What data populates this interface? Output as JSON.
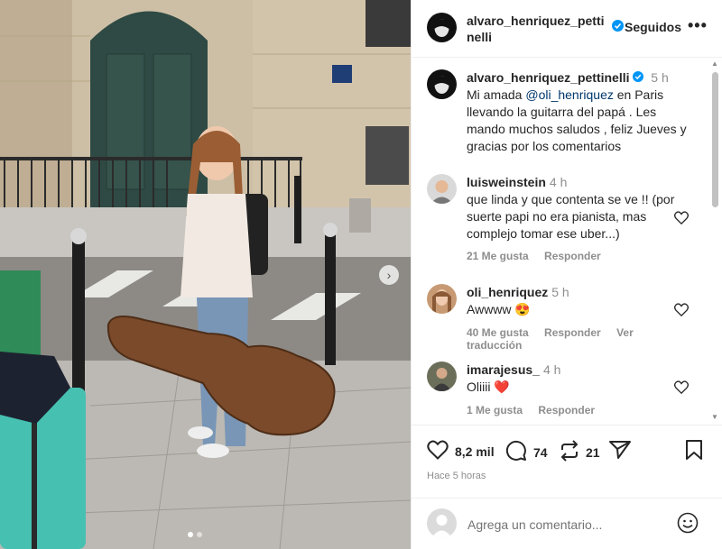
{
  "post": {
    "author": "alvaro_henriquez_pettinelli",
    "follow_status": "Seguidos",
    "more": "•••",
    "caption_time": "5 h",
    "caption_before": "Mi amada ",
    "caption_mention": "@oli_henriquez",
    "caption_after": " en Paris llevando la guitarra del papá . Les mando muchos saludos , feliz Jueves y gracias por los comentarios"
  },
  "comments": [
    {
      "user": "luisweinstein",
      "time": "4 h",
      "text": "que linda y que contenta se ve !! (por suerte papi no era pianista, mas complejo tomar ese uber...)",
      "likes": "21 Me gusta",
      "reply": "Responder",
      "translate": ""
    },
    {
      "user": "oli_henriquez",
      "time": "5 h",
      "text": "Awwww 😍",
      "likes": "40 Me gusta",
      "reply": "Responder",
      "translate": "Ver traducción"
    },
    {
      "user": "imarajesus_",
      "time": "4 h",
      "text": "Oliiii ❤️",
      "likes": "1 Me gusta",
      "reply": "Responder",
      "translate": ""
    }
  ],
  "actions": {
    "likes": "8,2 mil",
    "comments": "74",
    "reposts": "21",
    "time_ago": "Hace 5 horas"
  },
  "add_comment": {
    "placeholder": "Agrega un comentario..."
  },
  "colors": {
    "verified": "#0095f6",
    "link": "#00376b",
    "muted": "#8e8e8e"
  }
}
